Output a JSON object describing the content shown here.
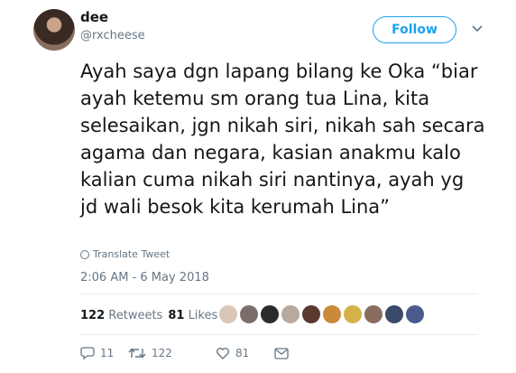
{
  "author": {
    "name": "dee",
    "handle": "@rxcheese"
  },
  "follow_label": "Follow",
  "tweet": {
    "text": "Ayah saya dgn lapang bilang ke Oka “biar ayah ketemu sm orang tua Lina, kita selesaikan, jgn nikah siri, nikah sah secara agama dan negara, kasian anakmu kalo kalian cuma nikah siri nantinya, ayah yg jd wali besok kita kerumah Lina”",
    "translate_label": "Translate Tweet",
    "timestamp": "2:06 AM - 6 May 2018"
  },
  "stats": {
    "retweets_count": "122",
    "retweets_label": "Retweets",
    "likes_count": "81",
    "likes_label": "Likes"
  },
  "liker_avatars": [
    "#d9c7b8",
    "#7a6f6a",
    "#2b2b2b",
    "#b8a9a0",
    "#5a3a2e",
    "#c98a3a",
    "#d4b24a",
    "#8a6d5e",
    "#3a4a6a",
    "#4a5a8a"
  ],
  "actions": {
    "reply_count": "11",
    "retweet_count": "122",
    "like_count": "81"
  },
  "colors": {
    "accent": "#1da1f2",
    "secondary_text": "#657786",
    "text": "#14171a"
  }
}
